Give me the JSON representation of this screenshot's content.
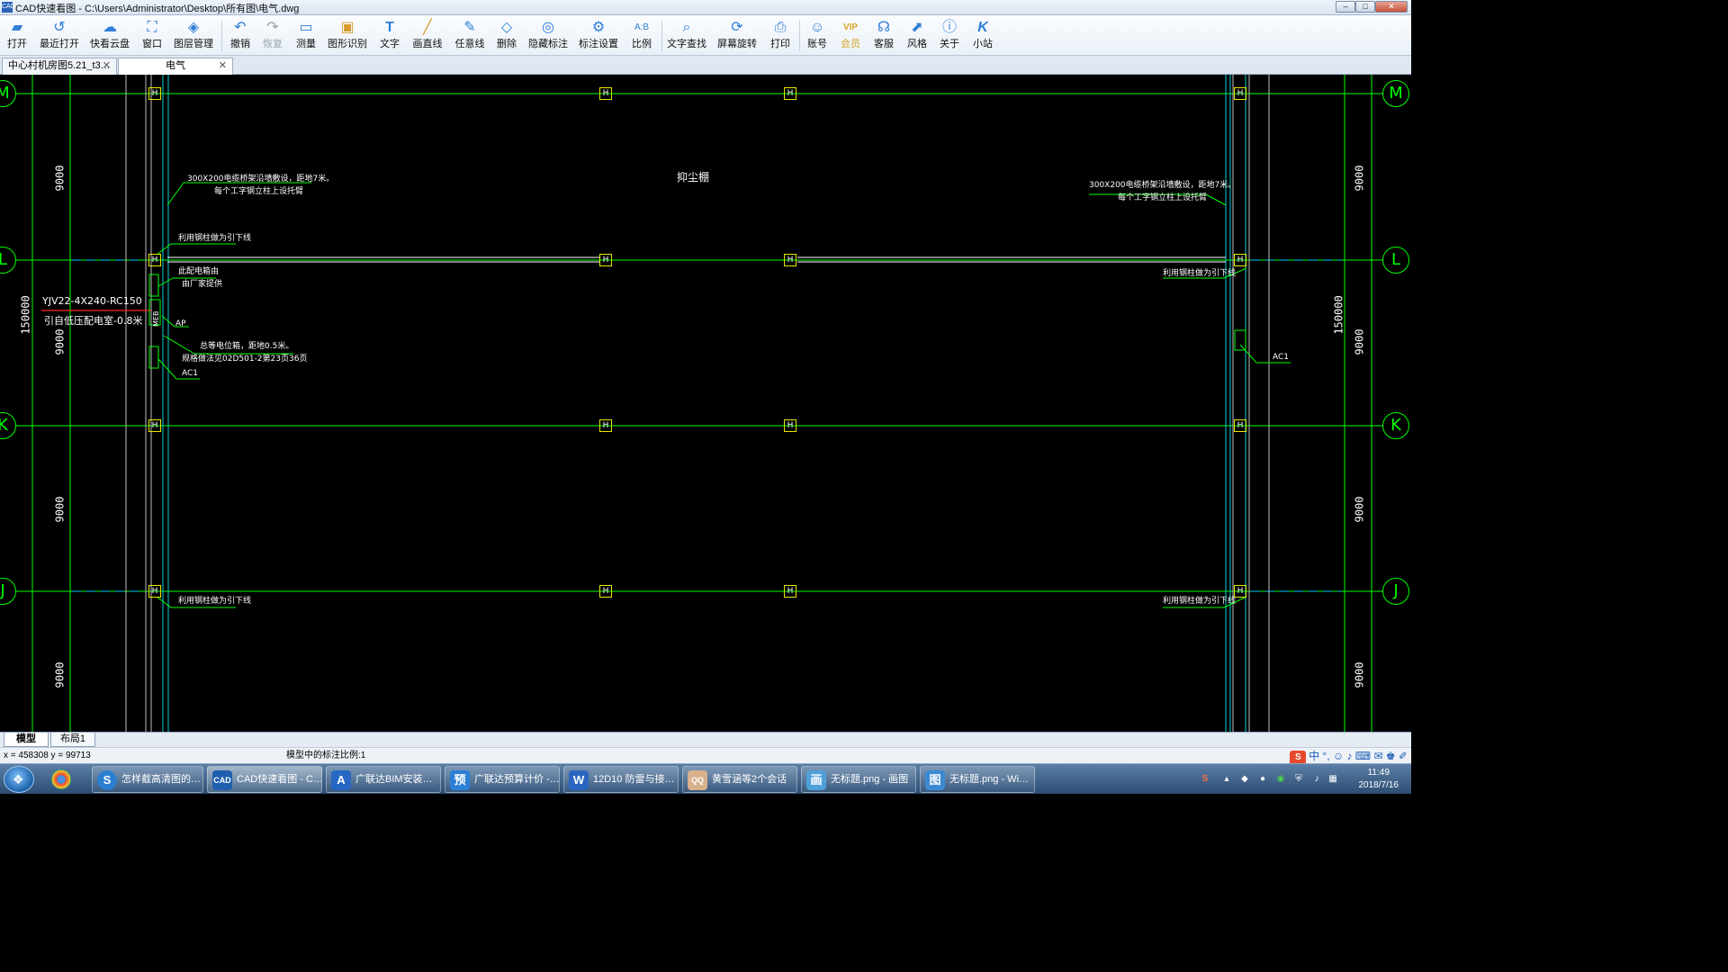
{
  "window": {
    "title": "CAD快速看图 - C:\\Users\\Administrator\\Desktop\\所有图\\电气.dwg",
    "app_icon_label": "CAD",
    "controls": [
      "minimize",
      "maximize",
      "close"
    ]
  },
  "toolbar": {
    "items": [
      {
        "label": "打开",
        "icon": "folder-open-icon"
      },
      {
        "label": "最近打开",
        "icon": "history-icon"
      },
      {
        "label": "快看云盘",
        "icon": "cloud-icon"
      },
      {
        "label": "窗口",
        "icon": "window-frame-icon"
      },
      {
        "label": "图层管理",
        "icon": "layers-icon"
      },
      {
        "label": "撤销",
        "icon": "undo-icon"
      },
      {
        "label": "恢复",
        "icon": "redo-icon",
        "disabled": true
      },
      {
        "label": "测量",
        "icon": "ruler-icon"
      },
      {
        "label": "图形识别",
        "icon": "shape-recognize-icon"
      },
      {
        "label": "文字",
        "icon": "text-icon"
      },
      {
        "label": "画直线",
        "icon": "line-icon"
      },
      {
        "label": "任意线",
        "icon": "pen-icon"
      },
      {
        "label": "删除",
        "icon": "eraser-icon"
      },
      {
        "label": "隐藏标注",
        "icon": "eye-hide-icon"
      },
      {
        "label": "标注设置",
        "icon": "annotation-settings-icon"
      },
      {
        "label": "比例",
        "icon": "scale-icon"
      },
      {
        "label": "文字查找",
        "icon": "text-search-icon"
      },
      {
        "label": "屏幕旋转",
        "icon": "screen-rotate-icon"
      },
      {
        "label": "打印",
        "icon": "printer-icon"
      },
      {
        "label": "账号",
        "icon": "user-icon"
      },
      {
        "label": "会员",
        "icon": "vip-icon",
        "vip": true
      },
      {
        "label": "客服",
        "icon": "headset-icon"
      },
      {
        "label": "风格",
        "icon": "style-icon"
      },
      {
        "label": "关于",
        "icon": "info-icon"
      },
      {
        "label": "小站",
        "icon": "k-logo-icon"
      }
    ]
  },
  "tabs": [
    {
      "label": "中心村机房图5.21_t3…",
      "active": false
    },
    {
      "label": "电气",
      "active": true
    }
  ],
  "drawing": {
    "grid_labels": [
      "M",
      "L",
      "K",
      "J"
    ],
    "dimensions": [
      "9000",
      "9000",
      "9000",
      "9000",
      "150000"
    ],
    "column_mark": "H",
    "room_label": "抑尘棚",
    "notes": {
      "tray_left": "300X200电缆桥架沿墙敷设，距地7米。",
      "tray_left_2": "每个工字钢立柱上设托臂",
      "tray_right": "300X200电缆桥架沿墙敷设，距地7米。",
      "tray_right_2": "每个工字钢立柱上设托臂",
      "down_conductor": "利用钢柱做为引下线",
      "meb_note_1": "总等电位箱，距地0.5米。",
      "meb_note_2": "规格做法见02D501-2第23页36页",
      "box_supply_1": "此配电箱由",
      "box_supply_2": "由厂家提供",
      "cable": "YJV22-4X240-RC150",
      "cable_note": "引自低压配电室-0.8米",
      "ap": "AP",
      "ac1": "AC1",
      "meb": "MEB"
    }
  },
  "layout_tabs": [
    {
      "label": "模型",
      "active": true
    },
    {
      "label": "布局1",
      "active": false
    }
  ],
  "status": {
    "coords": "x = 458308  y = 99713",
    "scale": "模型中的标注比例:1"
  },
  "taskbar": {
    "pinned": [
      {
        "name": "chrome",
        "icon": "chrome-icon"
      },
      {
        "name": "sogou-browser",
        "icon": "sogou-icon"
      }
    ],
    "tasks": [
      {
        "label": "怎样截高清图的…",
        "icon": "S",
        "color": "#2b7fd0"
      },
      {
        "label": "CAD快速看图 - C…",
        "icon": "CAD",
        "color": "#1f5fae",
        "active": true
      },
      {
        "label": "广联达BIM安装…",
        "icon": "A",
        "color": "#2767c4"
      },
      {
        "label": "广联达预算计价 -…",
        "icon": "预",
        "color": "#2d7fd6"
      },
      {
        "label": "12D10 防雷与接…",
        "icon": "W",
        "color": "#2a66bf"
      },
      {
        "label": "黄雪涵等2个会话",
        "icon": "QQ",
        "color": "#d8b18c"
      },
      {
        "label": "无标题.png - 画图",
        "icon": "画",
        "color": "#4fa0d8"
      },
      {
        "label": "无标题.png - Wi…",
        "icon": "图",
        "color": "#3b8ad0"
      }
    ],
    "clock": {
      "time": "11:49",
      "date": "2018/7/16"
    }
  },
  "colors": {
    "canvas": "#000000",
    "grid_line": "#00ff00",
    "column_box": "#e8e800",
    "cable_line": "#ff2020",
    "cad_text": "#ffffff"
  }
}
